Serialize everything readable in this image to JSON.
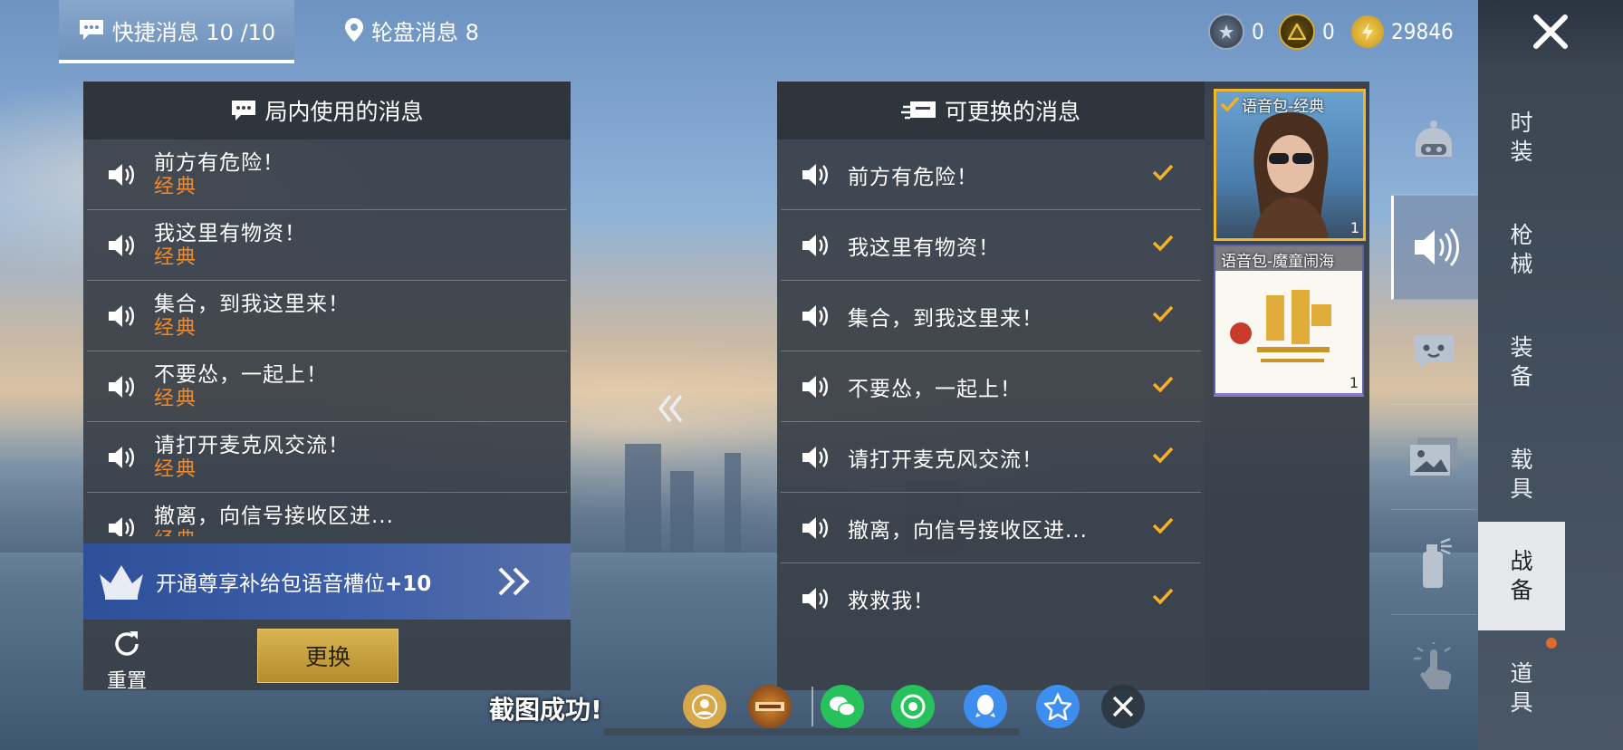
{
  "tabs": {
    "quick": "快捷消息 10 /10",
    "wheel": "轮盘消息  8"
  },
  "currency": [
    {
      "icon": "medal-icon",
      "value": "0"
    },
    {
      "icon": "badge-icon",
      "value": "0"
    },
    {
      "icon": "coin-icon",
      "value": "29846"
    }
  ],
  "left_panel": {
    "title": "局内使用的消息",
    "messages": [
      {
        "text": "前方有危险！",
        "tag": "经典"
      },
      {
        "text": "我这里有物资！",
        "tag": "经典"
      },
      {
        "text": "集合，到我这里来！",
        "tag": "经典"
      },
      {
        "text": "不要怂，一起上！",
        "tag": "经典"
      },
      {
        "text": "请打开麦克风交流！",
        "tag": "经典"
      },
      {
        "text": "撤离，向信号接收区进...",
        "tag": "经典"
      }
    ],
    "premium": {
      "text": "开通尊享补给包语音槽位",
      "bonus": "+10"
    },
    "reset_label": "重置",
    "swap_label": "更换"
  },
  "right_panel": {
    "title": "可更换的消息",
    "messages": [
      {
        "text": "前方有危险！"
      },
      {
        "text": "我这里有物资！"
      },
      {
        "text": "集合，到我这里来！"
      },
      {
        "text": "不要怂，一起上！"
      },
      {
        "text": "请打开麦克风交流！"
      },
      {
        "text": "撤离，向信号接收区进..."
      },
      {
        "text": "救救我！"
      }
    ]
  },
  "voice_packs": [
    {
      "label": "语音包-经典",
      "count": "1",
      "selected": true
    },
    {
      "label": "语音包-魔童闹海",
      "count": "1",
      "selected": false
    }
  ],
  "side_tabs": [
    "时\n装",
    "枪\n械",
    "装\n备",
    "载\n具",
    "战\n备",
    "道\n具"
  ],
  "toast": "截图成功!",
  "share_icons": [
    "avatar-share-icon",
    "game-logo-icon",
    "wechat-icon",
    "moments-icon",
    "qq-icon",
    "qzone-icon",
    "close-icon"
  ],
  "colors": {
    "accent": "#f08a2a",
    "check": "#f3b02a",
    "gold": "#d9b453"
  }
}
